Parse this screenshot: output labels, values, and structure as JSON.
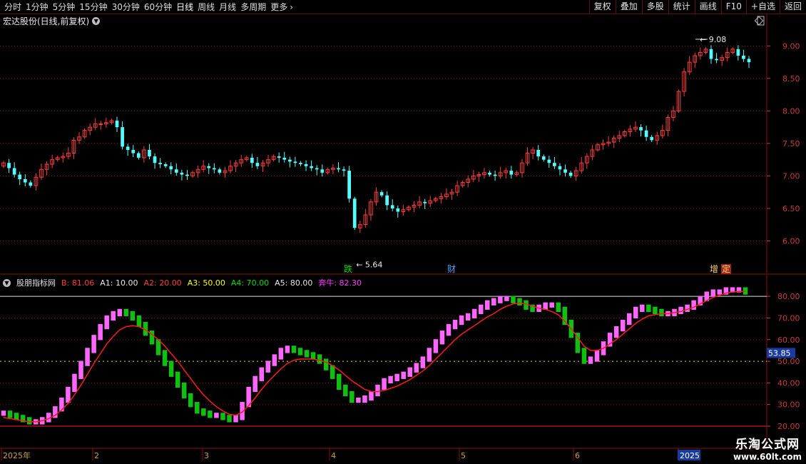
{
  "toolbar": {
    "periods": [
      "分时",
      "1分钟",
      "5分钟",
      "15分钟",
      "30分钟",
      "60分钟",
      "日线",
      "周线",
      "月线",
      "多周期",
      "更多"
    ],
    "active_period": "日线",
    "right_buttons": [
      "复权",
      "叠加",
      "多股",
      "统计",
      "画线",
      "F10",
      "+自选",
      "返回"
    ]
  },
  "main_title": "宏达股份(日线,前复权)",
  "main_axis": {
    "ticks": [
      "9.00",
      "8.50",
      "8.00",
      "7.50",
      "7.00",
      "6.50",
      "6.00"
    ]
  },
  "annotations": {
    "high_label": "9.08",
    "low_label": "5.64",
    "mark_die": "跌",
    "mark_cai": "财",
    "mark_zeng": "增",
    "mark_ding": "定"
  },
  "indicator": {
    "name": "股朋指标网",
    "items": [
      {
        "label": "B: 81.06",
        "color": "#ff3c3c"
      },
      {
        "label": "A1: 10.00",
        "color": "#e6e6e6"
      },
      {
        "label": "A2: 20.00",
        "color": "#ff3c3c"
      },
      {
        "label": "A3: 50.00",
        "color": "#ffff00"
      },
      {
        "label": "A4: 70.00",
        "color": "#00e000"
      },
      {
        "label": "A5: 80.00",
        "color": "#e6e6e6"
      },
      {
        "label": "奔牛: 82.30",
        "color": "#ff3cff"
      }
    ],
    "axis_ticks": [
      "80.00",
      "70.00",
      "60.00",
      "50.00",
      "40.00",
      "30.00",
      "20.00"
    ],
    "current_value": "53.85"
  },
  "date_labels": [
    "2025年",
    "2",
    "3",
    "4",
    "5",
    "6",
    "2025"
  ],
  "watermark": {
    "title": "乐淘公式网",
    "url": "www.60lt.com"
  },
  "colors": {
    "up": "#ff3c3c",
    "down": "#54ffff",
    "grid": "#8a1a1a",
    "bull": "#ff66ff",
    "bear": "#10c010",
    "line": "#ff1a1a"
  },
  "chart_data": {
    "type": "candlestick",
    "price_range": [
      5.5,
      9.3
    ],
    "indicator_range": [
      20,
      85
    ],
    "close": [
      7.2,
      7.12,
      7.02,
      6.95,
      6.9,
      6.85,
      6.98,
      7.1,
      7.18,
      7.25,
      7.28,
      7.3,
      7.35,
      7.55,
      7.6,
      7.7,
      7.75,
      7.8,
      7.8,
      7.82,
      7.85,
      7.75,
      7.45,
      7.4,
      7.35,
      7.28,
      7.4,
      7.3,
      7.2,
      7.18,
      7.15,
      7.1,
      7.05,
      7.02,
      7.0,
      7.05,
      7.1,
      7.15,
      7.12,
      7.1,
      7.05,
      7.08,
      7.15,
      7.2,
      7.25,
      7.28,
      7.2,
      7.15,
      7.2,
      7.25,
      7.3,
      7.28,
      7.25,
      7.22,
      7.2,
      7.18,
      7.15,
      7.12,
      7.1,
      7.05,
      7.1,
      7.12,
      7.1,
      7.08,
      6.65,
      6.2,
      6.25,
      6.4,
      6.6,
      6.75,
      6.7,
      6.55,
      6.5,
      6.45,
      6.48,
      6.52,
      6.55,
      6.6,
      6.58,
      6.62,
      6.65,
      6.68,
      6.72,
      6.75,
      6.85,
      6.9,
      6.95,
      7.0,
      7.02,
      7.05,
      7.02,
      7.0,
      7.05,
      7.08,
      7.02,
      7.05,
      7.2,
      7.35,
      7.4,
      7.3,
      7.25,
      7.2,
      7.15,
      7.1,
      7.05,
      7.0,
      7.08,
      7.2,
      7.3,
      7.4,
      7.48,
      7.5,
      7.52,
      7.58,
      7.62,
      7.68,
      7.72,
      7.75,
      7.7,
      7.6,
      7.55,
      7.62,
      7.7,
      7.9,
      8.0,
      8.3,
      8.6,
      8.75,
      8.85,
      8.9,
      8.95,
      8.8,
      8.78,
      8.82,
      8.9,
      8.95,
      8.85,
      8.8,
      8.75
    ],
    "bull_index": [
      26,
      25,
      24,
      23,
      22,
      22,
      23,
      25,
      28,
      32,
      37,
      43,
      49,
      55,
      61,
      66,
      70,
      72,
      73,
      72,
      70,
      67,
      63,
      59,
      54,
      49,
      44,
      39,
      34,
      30,
      27,
      26,
      25,
      25,
      24,
      23,
      24,
      30,
      37,
      42,
      46,
      49,
      52,
      55,
      56,
      55,
      54,
      53,
      52,
      50,
      47,
      43,
      38,
      35,
      32,
      32,
      33,
      35,
      38,
      41,
      42,
      43,
      44,
      46,
      48,
      51,
      55,
      59,
      63,
      66,
      68,
      70,
      71,
      73,
      75,
      77,
      78,
      79,
      79,
      78,
      77,
      75,
      74,
      75,
      76,
      76,
      74,
      68,
      62,
      55,
      50,
      51,
      54,
      58,
      62,
      65,
      68,
      71,
      74,
      75,
      74,
      73,
      72,
      72,
      73,
      74,
      75,
      77,
      79,
      81,
      82,
      82,
      83,
      83,
      83,
      82
    ],
    "bull_line": [
      24,
      23.5,
      23,
      22.5,
      22,
      22,
      22.5,
      23.5,
      25,
      27.5,
      30.5,
      34.5,
      39,
      44,
      49,
      53.5,
      58,
      61.5,
      64.5,
      66,
      66.5,
      66,
      64.5,
      62.5,
      60,
      57,
      53.5,
      50,
      46,
      42,
      38,
      34.5,
      31.5,
      29,
      27,
      25.5,
      25,
      26.5,
      29.5,
      33,
      37,
      40.5,
      43.5,
      46.5,
      49,
      50.5,
      51,
      51,
      51,
      50.5,
      49.5,
      48,
      46,
      43.5,
      41,
      39,
      37,
      36,
      36,
      36.5,
      37.5,
      38.5,
      40,
      41.5,
      43.5,
      45.5,
      48,
      51,
      54,
      57,
      60,
      62.5,
      64.5,
      66.5,
      68.5,
      70.5,
      72,
      74,
      75.5,
      76.5,
      77,
      76.5,
      75.5,
      74.5,
      74,
      73,
      71.5,
      68.5,
      65,
      61,
      57,
      55,
      55,
      56,
      58,
      60,
      62.5,
      65,
      67.5,
      69.5,
      71,
      71.5,
      72,
      72,
      72.5,
      73,
      74,
      75,
      76.5,
      78,
      79.5,
      80.5,
      81.5,
      82,
      82.3,
      82.3
    ]
  }
}
